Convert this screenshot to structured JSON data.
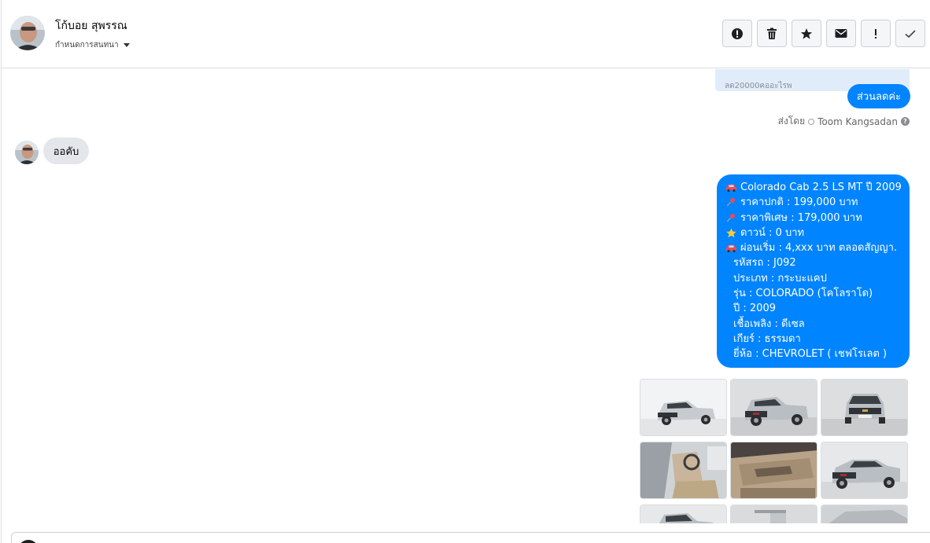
{
  "header": {
    "contact_name": "โก้บอย สุพรรณ",
    "conversation_menu": "กำหนดการสนทนา"
  },
  "toolbar": {
    "buttons": [
      {
        "name": "spam-button",
        "icon": "alert-circle-icon"
      },
      {
        "name": "delete-button",
        "icon": "trash-icon"
      },
      {
        "name": "star-button",
        "icon": "star-icon"
      },
      {
        "name": "mark-unread-button",
        "icon": "mail-icon"
      },
      {
        "name": "important-button",
        "icon": "exclamation-icon"
      },
      {
        "name": "done-button",
        "icon": "check-icon"
      }
    ]
  },
  "messages": {
    "card_text": "ลด20000คออะไรพ",
    "outgoing_1": "ส่วนลดค่ะ",
    "sent_by_label": "ส่งโดย",
    "sent_by_name": "Toom Kangsadan",
    "incoming_1": "ออคับ",
    "listing": {
      "lines": [
        "Colorado Cab 2.5 LS MT ปี 2009",
        "ราคาปกติ : 199,000 บาท",
        "ราคาพิเศษ : 179,000 บาท",
        "ดาวน์ : 0 บาท",
        "ผ่อนเริ่ม : 4,xxx บาท ตลอดสัญญา.",
        "รหัสรถ : J092",
        "ประเภท : กระบะแคป",
        "รุ่น : COLORADO (โคโลราโด)",
        "ปี : 2009",
        "เชื้อเพลิง : ดีเซล",
        "เกียร์ : ธรรมดา",
        "ยี่ห้อ : CHEVROLET ( เชฟโรเลต )"
      ]
    }
  },
  "colors": {
    "accent": "#0084ff",
    "incoming_bubble": "#e4e6eb",
    "card_bg": "#e1ecfb"
  }
}
